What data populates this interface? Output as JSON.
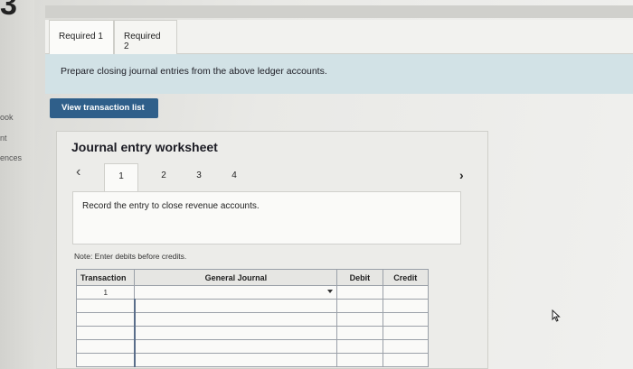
{
  "left_panel": {
    "digit": "3",
    "labels": [
      "ook",
      "nt",
      "ences"
    ]
  },
  "tabs": [
    {
      "label": "Required 1"
    },
    {
      "label": "Required 2"
    }
  ],
  "banner_text": "Prepare closing journal entries from the above ledger accounts.",
  "view_button_label": "View transaction list",
  "worksheet": {
    "title": "Journal entry worksheet",
    "steps": [
      "1",
      "2",
      "3",
      "4"
    ],
    "instruction": "Record the entry to close revenue accounts.",
    "note": "Note: Enter debits before credits."
  },
  "table": {
    "headers": {
      "transaction": "Transaction",
      "general_journal": "General Journal",
      "debit": "Debit",
      "credit": "Credit"
    },
    "first_transaction": "1"
  },
  "icons": {
    "prev": "chevron-left-icon",
    "next": "chevron-right-icon",
    "dropdown": "dropdown-caret-icon",
    "cursor": "mouse-pointer-icon"
  }
}
